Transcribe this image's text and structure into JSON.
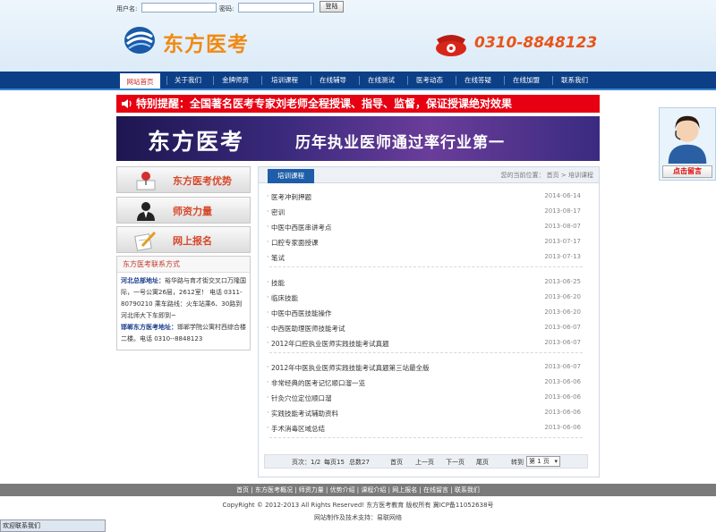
{
  "login": {
    "user_label": "用户名:",
    "pass_label": "密码:",
    "button": "登陆"
  },
  "logo": {
    "text": "东方医考"
  },
  "phone": {
    "number": "0310-8848123"
  },
  "nav": [
    "网站首页",
    "关于我们",
    "金牌师资",
    "培训课程",
    "在线辅导",
    "在线测试",
    "医考动态",
    "在线答疑",
    "在线加盟",
    "联系我们"
  ],
  "nav_active": 0,
  "notice": "特别提醒：全国著名医考专家刘老师全程授课、指导、监督，保证授课绝对效果",
  "banner": {
    "title": "东方医考",
    "slogan": "历年执业医师通过率行业第一"
  },
  "side_buttons": [
    "东方医考优势",
    "师资力量",
    "网上报名"
  ],
  "contact": {
    "title": "东方医考联系方式",
    "hebei_label": "河北总部地址：",
    "hebei_text": "裕华路与育才街交叉口万隆国际，一号公寓26层，2612室！ 电话 0311-80790210 乘车路线：火车站乘6、30路到河北师大下车即到~",
    "handan_label": "邯郸东方医考地址：",
    "handan_text": "邯郸学院公寓村西综合楼二楼。电话 0310--8848123"
  },
  "main": {
    "tab": "培训课程",
    "crumb": "您的当前位置： 首页 > 培训课程",
    "groups": [
      [
        {
          "title": "医考冲刺押题",
          "date": "2014-06-14"
        },
        {
          "title": "密训",
          "date": "2013-08-17"
        },
        {
          "title": "中医中西医串讲考点",
          "date": "2013-08-07"
        },
        {
          "title": "口腔专家面授课",
          "date": "2013-07-17"
        },
        {
          "title": "笔试",
          "date": "2013-07-13"
        }
      ],
      [
        {
          "title": "技能",
          "date": "2013-06-25"
        },
        {
          "title": "临床技能",
          "date": "2013-06-20"
        },
        {
          "title": "中医中西医技能操作",
          "date": "2013-06-20"
        },
        {
          "title": "中西医助理医师技能考试",
          "date": "2013-06-07"
        },
        {
          "title": "2012年口腔执业医师实践技能考试真题",
          "date": "2013-06-07"
        }
      ],
      [
        {
          "title": "2012年中医执业医师实践技能考试真题第三站最全版",
          "date": "2013-06-07"
        },
        {
          "title": "非常经典的医考记忆顺口溜一览",
          "date": "2013-06-06"
        },
        {
          "title": "针灸穴位定位顺口溜",
          "date": "2013-06-06"
        },
        {
          "title": "实践技能考试辅助资料",
          "date": "2013-06-06"
        },
        {
          "title": "手术消毒区域总结",
          "date": "2013-06-06"
        }
      ]
    ],
    "pager": {
      "page": "页次：1/2",
      "per": "每页15",
      "total": "总数27",
      "first": "首页",
      "prev": "上一页",
      "next": "下一页",
      "last": "尾页",
      "goto": "转到",
      "select": "第 1 页"
    }
  },
  "service": {
    "button": "点击留言"
  },
  "footer": {
    "nav": "首页 | 东方医考概况 | 师资力量 | 优势介绍 | 课程介绍 | 网上报名 | 在线留言 | 联系我们",
    "copyright": "CopyRight © 2012-2013 All Rights Reserved! 东方医考教育 版权所有 冀ICP备11052638号",
    "support": "网站制作及技术支持：易联网络"
  },
  "float_bar": "欢迎联系我们",
  "colors": {
    "nav": "#0c3f86",
    "notice": "#e60012",
    "logo": "#f08a13",
    "phone": "#e8541a"
  }
}
